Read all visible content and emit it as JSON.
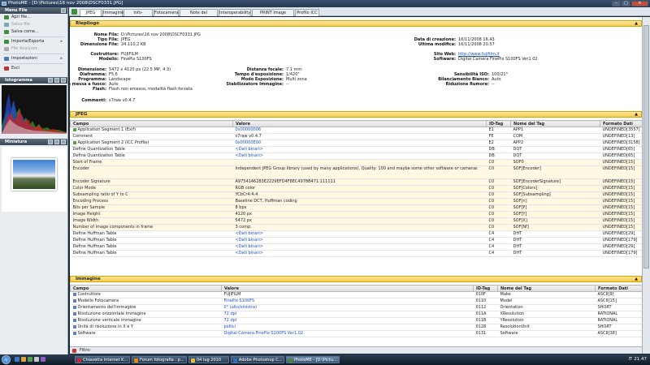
{
  "window": {
    "title": "PhotoME - [D:\\Pictures\\16 nov 2008\\DSCF0331.JPG]"
  },
  "left": {
    "menu_title": "Menu File",
    "menu_items": [
      {
        "label": "Apri file...",
        "enabled": true,
        "icon": "open-folder-icon"
      },
      {
        "label": "Salva file",
        "enabled": false,
        "icon": "save-icon"
      },
      {
        "label": "Salva come...",
        "enabled": true,
        "icon": "save-as-icon"
      },
      {
        "label": "Importa/Esporta",
        "enabled": true,
        "icon": "import-export-icon",
        "submenu": true
      },
      {
        "label": "File Analyzer...",
        "enabled": false,
        "icon": "analyzer-icon"
      },
      {
        "label": "Impostazioni",
        "enabled": true,
        "icon": "settings-icon",
        "submenu": true
      },
      {
        "label": "Esci",
        "enabled": true,
        "icon": "exit-icon"
      }
    ],
    "histogram_title": "Istogramma",
    "thumbnail_title": "Miniatura"
  },
  "tabs": [
    "JPEG",
    "Immagine",
    "Info-Miniatura",
    "Fotocamera",
    "Note del Costruttore",
    "Interoperability",
    "PRINT Image Matching",
    "Profilo ICC"
  ],
  "riepilogo": {
    "title": "Riepilogo",
    "nome_file": {
      "label": "Nome File:",
      "value": "D:\\Pictures\\16 nov 2008\\DSCF0331.JPG"
    },
    "tipo_file": {
      "label": "Tipo File:",
      "value": "JPEG"
    },
    "dim_file": {
      "label": "Dimensione File:",
      "value": "24.110,2 KB"
    },
    "data_creazione": {
      "label": "Data di creazione:",
      "value": "16/11/2008 16.43"
    },
    "ultima_modifica": {
      "label": "Ultima modifica:",
      "value": "16/11/2008 20.57"
    },
    "costruttore": {
      "label": "Costruttore:",
      "value": "FUJIFILM"
    },
    "modello": {
      "label": "Modello:",
      "value": "FinePix S100FS"
    },
    "sito_web": {
      "label": "Sito Web:",
      "value": "http://www.fujifilm.it"
    },
    "software": {
      "label": "Software:",
      "value": "Digital Camera FinePix S100FS  Ver1.02"
    },
    "dimensione": {
      "label": "Dimensione:",
      "value": "5472 x 4120 px (22.5 MP, 4:3)"
    },
    "diaframma": {
      "label": "Diaframma:",
      "value": "F5.6"
    },
    "programma": {
      "label": "Programma:",
      "value": "Landscape"
    },
    "modo_messa": {
      "label": "Modo messa a fuoco:",
      "value": "Auto"
    },
    "flash": {
      "label": "Flash:",
      "value": "Flash non emesso, modalità flash forzata"
    },
    "distanza": {
      "label": "Distanza focale:",
      "value": "7.1 mm"
    },
    "tempo": {
      "label": "Tempo d'esposizione:",
      "value": "1/420\""
    },
    "modo_esp": {
      "label": "Modo Esposizione:",
      "value": "Multi zona"
    },
    "stabilizzatore": {
      "label": "Stabilizzatore Immagine:",
      "value": "--"
    },
    "iso": {
      "label": "Sensibilità ISO:",
      "value": "100/21°"
    },
    "bilanciamento": {
      "label": "Bilanciamento Bianco:",
      "value": "Auto"
    },
    "riduzione": {
      "label": "Riduzione Rumore:",
      "value": "--"
    },
    "commenti": {
      "label": "Commenti:",
      "value": "s7raw v0.4.7"
    }
  },
  "jpeg": {
    "title": "JPEG",
    "headers": [
      "Campo",
      "Valore",
      "ID-Tag",
      "Nome del Tag",
      "Formato Dati"
    ],
    "rows": [
      {
        "c": "Application Segment 1 (Exif)",
        "v": "0x00000006",
        "id": "E1",
        "n": "APP1",
        "f": "UNDEFINED[3557]",
        "icon": true,
        "link": true
      },
      {
        "c": "Comment",
        "v": "s7raw v0.4.7",
        "id": "FE",
        "n": "COM",
        "f": "UNDEFINED[13]"
      },
      {
        "c": "Application Segment 2 (ICC Profile)",
        "v": "0x00000E00",
        "id": "E2",
        "n": "APP2",
        "f": "UNDEFINED[3158]",
        "icon": true,
        "link": true
      },
      {
        "c": "Define Quantization Table",
        "v": "<Dati binari>",
        "id": "DB",
        "n": "DQT",
        "f": "UNDEFINED[65]",
        "link": true
      },
      {
        "c": "Define Quantization Table",
        "v": "<Dati binari>",
        "id": "DB",
        "n": "DQT",
        "f": "UNDEFINED[65]",
        "link": true
      },
      {
        "c": "Start of Frame",
        "v": "",
        "id": "C0",
        "n": "SOF0",
        "f": "UNDEFINED[15]",
        "grp": true
      },
      {
        "c": "Encoder",
        "v": "Independent JPEG Group library (used by many applications), Quality: 100 and maybe some other software or cameras",
        "id": "C0",
        "n": "SOF[Encoder]",
        "f": "UNDEFINED[15]",
        "grp": true,
        "tall": true
      },
      {
        "c": "Encoder Signature",
        "v": "A9754146283E2229EFD4F8EC4978B471:111111",
        "id": "C0",
        "n": "SOF[EncoderSignature]",
        "f": "UNDEFINED[15]",
        "grp": true
      },
      {
        "c": "Color Mode",
        "v": "RGB color",
        "id": "C0",
        "n": "SOF[Colors]",
        "f": "UNDEFINED[15]",
        "grp": true
      },
      {
        "c": "Subsampling ratio of Y to C",
        "v": "YCbCr4:4:4",
        "id": "C0",
        "n": "SOF[Subsampling]",
        "f": "UNDEFINED[15]",
        "grp": true
      },
      {
        "c": "Encoding Process",
        "v": "Baseline DCT, Huffman coding",
        "id": "C0",
        "n": "SOF[n]",
        "f": "UNDEFINED[15]",
        "grp": true
      },
      {
        "c": "Bits per Sample",
        "v": "8 bps",
        "id": "C0",
        "n": "SOF[P]",
        "f": "UNDEFINED[15]",
        "grp": true
      },
      {
        "c": "Image Height",
        "v": "4120 px",
        "id": "C0",
        "n": "SOF[Y]",
        "f": "UNDEFINED[15]",
        "grp": true
      },
      {
        "c": "Image Width",
        "v": "5472 px",
        "id": "C0",
        "n": "SOF[X]",
        "f": "UNDEFINED[15]",
        "grp": true
      },
      {
        "c": "Number of image components in frame",
        "v": "3 comp.",
        "id": "C0",
        "n": "SOF[Nf]",
        "f": "UNDEFINED[15]",
        "grp": true
      },
      {
        "c": "Define Huffman Table",
        "v": "<Dati binari>",
        "id": "C4",
        "n": "DHT",
        "f": "UNDEFINED[29]",
        "link": true
      },
      {
        "c": "Define Huffman Table",
        "v": "<Dati binari>",
        "id": "C4",
        "n": "DHT",
        "f": "UNDEFINED[179]",
        "link": true
      },
      {
        "c": "Define Huffman Table",
        "v": "<Dati binari>",
        "id": "C4",
        "n": "DHT",
        "f": "UNDEFINED[29]",
        "link": true
      },
      {
        "c": "Define Huffman Table",
        "v": "<Dati binari>",
        "id": "C4",
        "n": "DHT",
        "f": "UNDEFINED[179]",
        "link": true
      }
    ]
  },
  "immagine": {
    "title": "Immagine",
    "headers": [
      "Campo",
      "Valore",
      "ID-Tag",
      "Nome del Tag",
      "Formato Dati"
    ],
    "rows": [
      {
        "c": "Costruttore",
        "v": "FUJIFILM",
        "id": "010F",
        "n": "Make",
        "f": "ASCII[9]",
        "icon": true
      },
      {
        "c": "Modello Fotocamera",
        "v": "FinePix S100FS",
        "id": "0110",
        "n": "Model",
        "f": "ASCII[15]",
        "icon": true,
        "link": true
      },
      {
        "c": "Orientamento dell'immagine",
        "v": "0° (alto/sinistra)",
        "id": "0112",
        "n": "Orientation",
        "f": "SHORT",
        "icon": true,
        "link": true
      },
      {
        "c": "Risoluzione orizzontale immagine",
        "v": "72 dpi",
        "id": "011A",
        "n": "XResolution",
        "f": "RATIONAL",
        "icon": true,
        "link": true
      },
      {
        "c": "Risoluzione verticale immagine",
        "v": "72 dpi",
        "id": "011B",
        "n": "YResolution",
        "f": "RATIONAL",
        "icon": true,
        "link": true
      },
      {
        "c": "Unità di risoluzione in X e Y",
        "v": "pollici",
        "id": "0128",
        "n": "ResolutionUnit",
        "f": "SHORT",
        "icon": true,
        "link": true
      },
      {
        "c": "Software",
        "v": "Digital Camera FinePix S100FS  Ver1.02",
        "id": "0131",
        "n": "Software",
        "f": "ASCII[38]",
        "icon": true,
        "link": true
      }
    ]
  },
  "filter": {
    "label": "Filtro:"
  },
  "taskbar": {
    "tasks": [
      {
        "label": "Chiavetta Internet K...",
        "color": "#d23"
      },
      {
        "label": "Forum fotografia : p...",
        "color": "#e80"
      },
      {
        "label": "04 lug 2010",
        "color": "#eb3"
      },
      {
        "label": "Adobe Photoshop C...",
        "color": "#2a6fc4"
      },
      {
        "label": "PhotoME - [D:\\Pictu...",
        "color": "#4c8a3a"
      }
    ],
    "tray": "IT",
    "clock": "21.47"
  },
  "colors": {
    "accent": "#f7cc55",
    "link": "#1a4fd0"
  }
}
